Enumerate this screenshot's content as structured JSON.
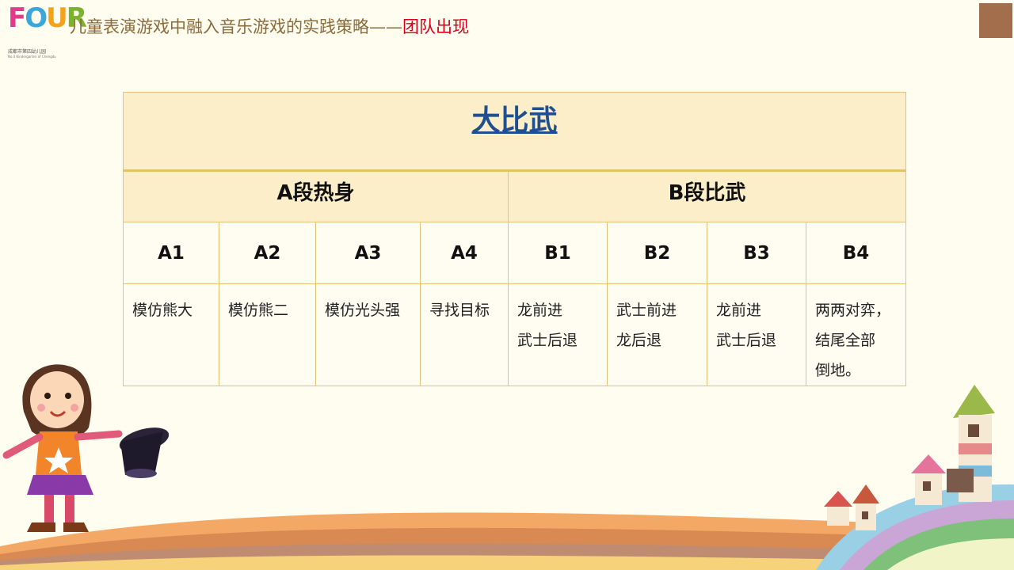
{
  "header": {
    "logo_text": "FOUR",
    "logo_sub": "成都市第四幼儿园",
    "logo_sub_en": "No.4 Kindergarten of Chengdu",
    "title_main": "儿童表演游戏中融入音乐游戏的实践策略——",
    "title_accent": "团队出现"
  },
  "table": {
    "title": "大比武",
    "sections": [
      {
        "label": "A段热身"
      },
      {
        "label": "B段比武"
      }
    ],
    "columns": [
      {
        "code": "A1",
        "lines": [
          "模仿熊大"
        ]
      },
      {
        "code": "A2",
        "lines": [
          "模仿熊二"
        ]
      },
      {
        "code": "A3",
        "lines": [
          "模仿光头强"
        ]
      },
      {
        "code": "A4",
        "lines": [
          "寻找目标"
        ]
      },
      {
        "code": "B1",
        "lines": [
          "龙前进",
          "武士后退"
        ]
      },
      {
        "code": "B2",
        "lines": [
          "武士前进",
          "龙后退"
        ]
      },
      {
        "code": "B3",
        "lines": [
          "龙前进",
          "武士后退"
        ]
      },
      {
        "code": "B4",
        "lines": [
          "两两对弈，",
          "结尾全部",
          "倒地。"
        ]
      }
    ]
  },
  "colors": {
    "background": "#fffdf0",
    "header_title": "#8a6a3a",
    "header_accent": "#d6001c",
    "table_title": "#1f4f8f",
    "table_header_bg": "#fbeec8",
    "table_border": "#e4c27a",
    "corner_box": "#a26e4b"
  }
}
